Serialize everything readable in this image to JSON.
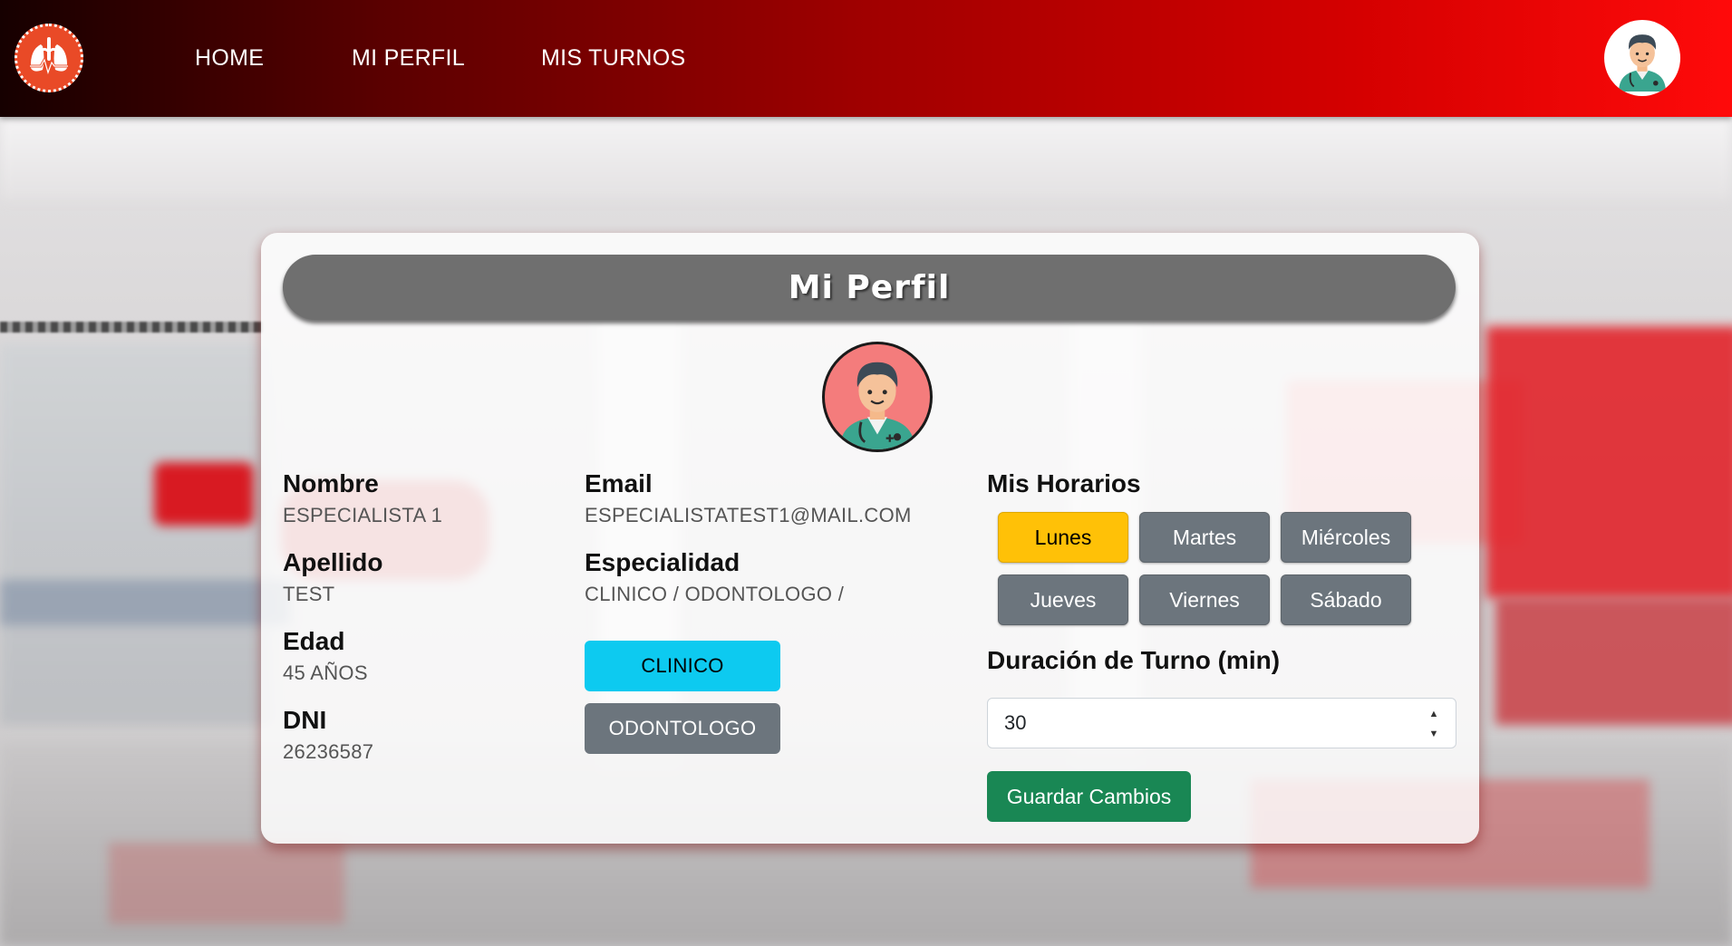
{
  "nav": {
    "links": [
      "HOME",
      "MI PERFIL",
      "MIS TURNOS"
    ]
  },
  "profile": {
    "title": "Mi Perfil",
    "fields": [
      {
        "label": "Nombre",
        "value": "ESPECIALISTA 1"
      },
      {
        "label": "Apellido",
        "value": "TEST"
      },
      {
        "label": "Edad",
        "value": "45 AÑOS"
      },
      {
        "label": "DNI",
        "value": "26236587"
      }
    ],
    "email": {
      "label": "Email",
      "value": "ESPECIALISTATEST1@MAIL.COM"
    },
    "especialidad": {
      "label": "Especialidad",
      "value": "CLINICO / ODONTOLOGO /"
    },
    "specialty_buttons": [
      {
        "label": "CLINICO",
        "color": "#0dcaf0",
        "selected": true
      },
      {
        "label": "ODONTOLOGO",
        "color": "#6c757d",
        "selected": false
      }
    ]
  },
  "schedule": {
    "title": "Mis Horarios",
    "days": [
      {
        "label": "Lunes",
        "active": true
      },
      {
        "label": "Martes",
        "active": false
      },
      {
        "label": "Miércoles",
        "active": false
      },
      {
        "label": "Jueves",
        "active": false
      },
      {
        "label": "Viernes",
        "active": false
      },
      {
        "label": "Sábado",
        "active": false
      }
    ],
    "duration_label": "Duración de Turno (min)",
    "duration_value": "30",
    "save_label": "Guardar Cambios"
  },
  "colors": {
    "navbar_start": "#160000",
    "navbar_end": "#ff0a0a",
    "active_day": "#ffc107",
    "inactive_day": "#6c757d",
    "save_button": "#198754",
    "title_bar": "#6f6f6f"
  },
  "icons": {
    "logo": "lungs-heartbeat-logo",
    "user_avatar": "doctor-avatar-icon"
  }
}
